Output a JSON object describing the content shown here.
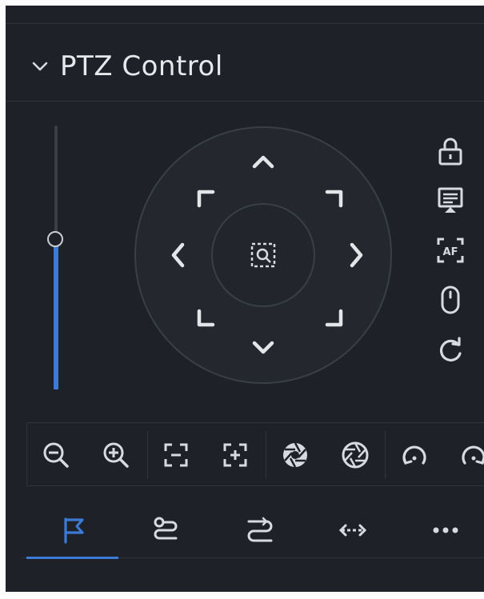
{
  "header": {
    "title": "PTZ Control",
    "collapse_icon": "chevron-down-icon"
  },
  "speed_slider": {
    "level": 0.57,
    "min": 0,
    "max": 1
  },
  "direction_pad": {
    "buttons": [
      "up",
      "up-right",
      "right",
      "down-right",
      "down",
      "down-left",
      "left",
      "up-left"
    ],
    "center": "zoom-area-icon"
  },
  "side_tools": [
    "lock-icon",
    "osd-menu-icon",
    "autofocus-icon",
    "mouse-icon",
    "refresh-icon"
  ],
  "toolbar": {
    "groups": [
      [
        "zoom-out-icon",
        "zoom-in-icon"
      ],
      [
        "focus-far-icon",
        "focus-near-icon"
      ],
      [
        "iris-open-icon",
        "iris-close-icon"
      ],
      [
        "rotate-left-icon",
        "rotate-right-icon"
      ]
    ]
  },
  "tabs": {
    "items": [
      "preset-flag-icon",
      "route-icon",
      "tour-icon",
      "scan-icon",
      "more-icon"
    ],
    "active": 0
  },
  "colors": {
    "panel": "#1e2127",
    "accent": "#3b7bd6",
    "icon": "#d7dae0",
    "ring": "#3a3f46"
  }
}
